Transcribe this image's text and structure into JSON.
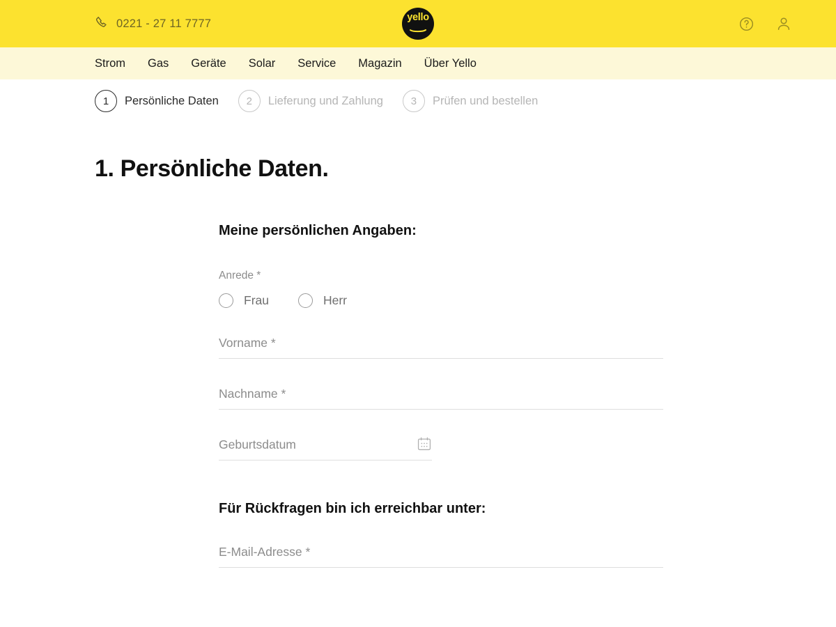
{
  "brand": {
    "logo_text": "yello",
    "logo_icon": "yello-logo",
    "yellow": "#FCE22F",
    "nav_yellow": "#FDF8D8",
    "black": "#111111"
  },
  "topbar": {
    "phone_icon": "phone-icon",
    "phone_number": "0221 - 27 11 7777",
    "help_icon": "help-circle-icon",
    "account_icon": "user-icon"
  },
  "nav": {
    "items": [
      {
        "label": "Strom"
      },
      {
        "label": "Gas"
      },
      {
        "label": "Geräte"
      },
      {
        "label": "Solar"
      },
      {
        "label": "Service"
      },
      {
        "label": "Magazin"
      },
      {
        "label": "Über Yello"
      }
    ]
  },
  "stepper": {
    "steps": [
      {
        "number": "1",
        "label": "Persönliche Daten",
        "active": true
      },
      {
        "number": "2",
        "label": "Lieferung und Zahlung",
        "active": false
      },
      {
        "number": "3",
        "label": "Prüfen und bestellen",
        "active": false
      }
    ]
  },
  "page": {
    "title": "1. Persönliche Daten."
  },
  "form": {
    "section_personal": "Meine persönlichen Angaben:",
    "salutation_label": "Anrede *",
    "salutation_options": [
      {
        "label": "Frau",
        "selected": false
      },
      {
        "label": "Herr",
        "selected": false
      }
    ],
    "firstname": {
      "placeholder": "Vorname *",
      "value": ""
    },
    "lastname": {
      "placeholder": "Nachname *",
      "value": ""
    },
    "birthdate": {
      "placeholder": "Geburtsdatum",
      "value": "",
      "icon": "calendar-icon"
    },
    "section_contact": "Für Rückfragen bin ich erreichbar unter:",
    "email": {
      "placeholder": "E-Mail-Adresse *",
      "value": ""
    }
  }
}
